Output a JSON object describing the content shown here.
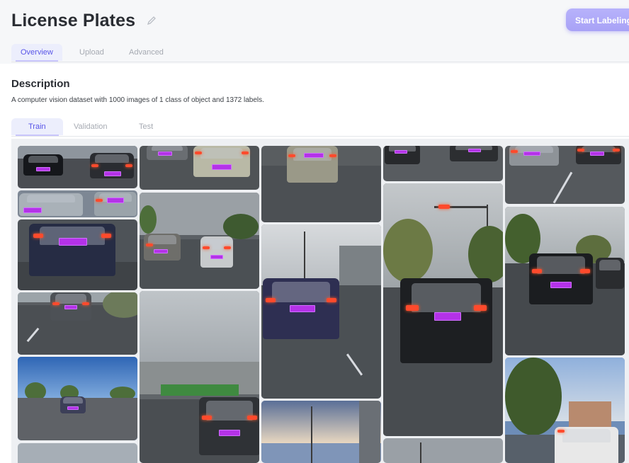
{
  "project": {
    "title": "License Plates",
    "start_label": "Start Labeling"
  },
  "icons": {
    "edit": "pencil-icon"
  },
  "colors": {
    "accent": "#5a56e8",
    "button": "#aba5f7",
    "label_box": "#b432e8"
  },
  "nav_tabs": [
    {
      "label": "Overview",
      "active": true
    },
    {
      "label": "Upload",
      "active": false
    },
    {
      "label": "Advanced",
      "active": false
    }
  ],
  "description": {
    "heading": "Description",
    "text": "A computer vision dataset with 1000 images of 1 class of object and 1372 labels."
  },
  "split_tabs": [
    {
      "label": "Train",
      "active": true
    },
    {
      "label": "Validation",
      "active": false
    },
    {
      "label": "Test",
      "active": false
    }
  ]
}
